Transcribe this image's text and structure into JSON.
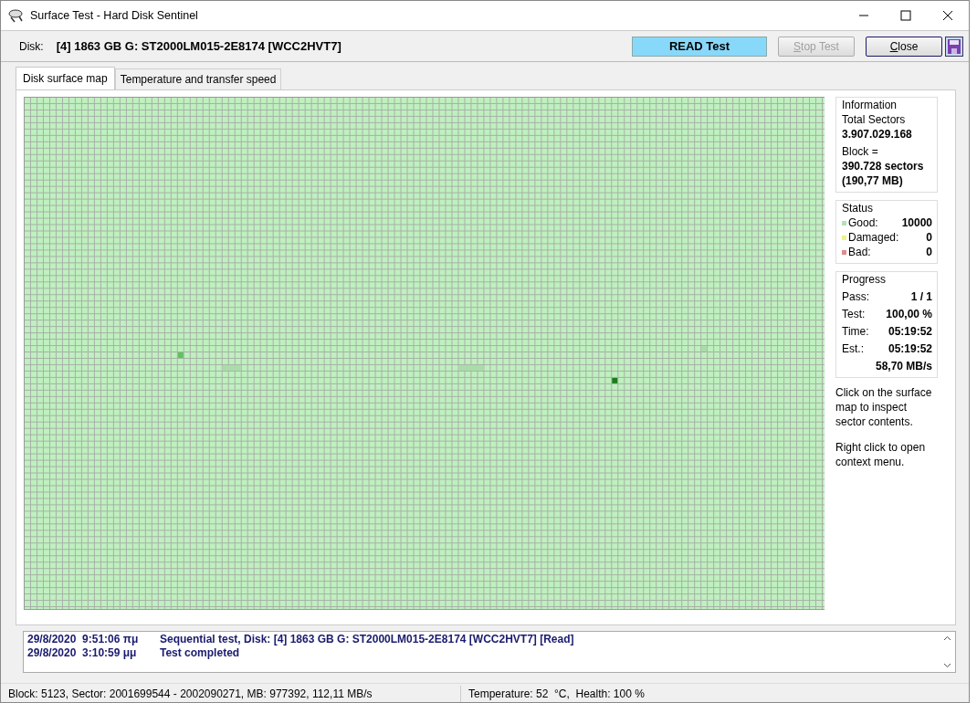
{
  "window": {
    "title": "Surface Test - Hard Disk Sentinel"
  },
  "toolbar": {
    "disk_label": "Disk:",
    "disk": "[4] 1863 GB G: ST2000LM015-2E8174 [WCC2HVT7]",
    "buttons": [
      {
        "label": "READ Test",
        "kind": "indicator",
        "disabled": false,
        "mnemonic": false
      },
      {
        "label": "Stop Test",
        "kind": "button",
        "disabled": true,
        "mnemonic": true
      },
      {
        "label": "Close",
        "kind": "button",
        "disabled": false,
        "mnemonic": true
      }
    ]
  },
  "tabs": [
    {
      "label": "Disk surface map",
      "selected": true
    },
    {
      "label": "Temperature and transfer speed",
      "selected": false
    }
  ],
  "information": {
    "title": "Information",
    "total_label": "Total Sectors",
    "total_value": "3.907.029.168",
    "block_label": "Block =",
    "block_value": "390.728 sectors",
    "block_size": "(190,77 MB)"
  },
  "status": {
    "title": "Status",
    "items": [
      {
        "label": "Good:",
        "value": "10000",
        "color": "#b4e2b4"
      },
      {
        "label": "Damaged:",
        "value": "0",
        "color": "#f0f08c"
      },
      {
        "label": "Bad:",
        "value": "0",
        "color": "#e08c8c"
      }
    ]
  },
  "progress": {
    "title": "Progress",
    "rows": [
      {
        "label": "Pass:",
        "value": "1 / 1"
      },
      {
        "label": "Test:",
        "value": "100,00 %"
      },
      {
        "label": "Time:",
        "value": "05:19:52"
      },
      {
        "label": "Est.:",
        "value": "05:19:52"
      }
    ],
    "speed": "58,70 MB/s"
  },
  "hints": [
    "Click on the surface map to inspect sector contents.",
    "Right click to open context menu."
  ],
  "log": [
    {
      "time": "29/8/2020  9:51:06 πμ",
      "message": "Sequential test, Disk: [4] 1863 GB G: ST2000LM015-2E8174 [WCC2HVT7] [Read]"
    },
    {
      "time": "29/8/2020  3:10:59 μμ",
      "message": "Test completed"
    }
  ],
  "status_bar": [
    "Block: 5123, Sector: 2001699544 - 2002090271, MB: 977392, 112,11 MB/s",
    "Temperature: 52  °C,  Health: 100 %"
  ]
}
